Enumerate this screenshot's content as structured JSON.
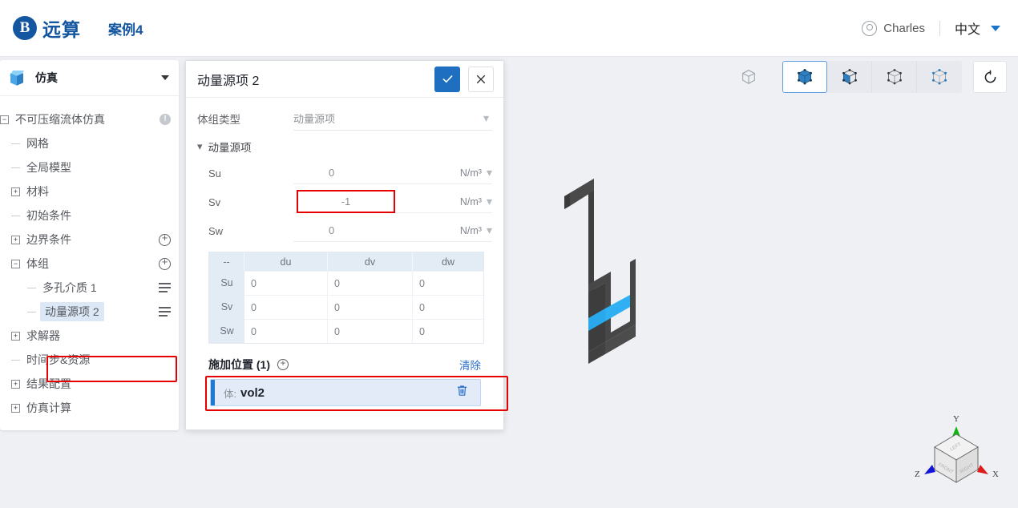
{
  "header": {
    "logo_letter": "B",
    "logo_text": "远算",
    "case_name": "案例4",
    "user_name": "Charles",
    "user_icon": "user-circle-icon",
    "language": "中文",
    "language_caret": "caret-down-icon"
  },
  "sidebar": {
    "title": "仿真",
    "title_icon": "cube-icon",
    "collapse_icon": "caret-down-icon",
    "tree": [
      {
        "label": "不可压缩流体仿真",
        "level": 0,
        "toggle": "minus",
        "badge": "warning-icon",
        "selected": false
      },
      {
        "label": "网格",
        "level": 1,
        "toggle": "dash",
        "badge": "",
        "selected": false
      },
      {
        "label": "全局模型",
        "level": 1,
        "toggle": "dash",
        "badge": "",
        "selected": false
      },
      {
        "label": "材料",
        "level": 1,
        "toggle": "plus",
        "badge": "",
        "selected": false
      },
      {
        "label": "初始条件",
        "level": 1,
        "toggle": "dash",
        "badge": "",
        "selected": false
      },
      {
        "label": "边界条件",
        "level": 1,
        "toggle": "plus",
        "badge": "add-icon",
        "selected": false
      },
      {
        "label": "体组",
        "level": 1,
        "toggle": "minus",
        "badge": "add-icon",
        "selected": false
      },
      {
        "label": "多孔介质 1",
        "level": 2,
        "toggle": "dash",
        "badge": "list-icon",
        "selected": false
      },
      {
        "label": "动量源项 2",
        "level": 2,
        "toggle": "dash",
        "badge": "list-icon",
        "selected": true
      },
      {
        "label": "求解器",
        "level": 1,
        "toggle": "plus",
        "badge": "",
        "selected": false
      },
      {
        "label": "时间步&资源",
        "level": 1,
        "toggle": "dash",
        "badge": "",
        "selected": false
      },
      {
        "label": "结果配置",
        "level": 1,
        "toggle": "plus",
        "badge": "",
        "selected": false
      },
      {
        "label": "仿真计算",
        "level": 1,
        "toggle": "plus",
        "badge": "",
        "selected": false
      }
    ]
  },
  "panel": {
    "title": "动量源项 2",
    "confirm_icon": "check-icon",
    "cancel_icon": "close-icon",
    "type_label": "体组类型",
    "type_value": "动量源项",
    "type_chevron": "chevron-down-icon",
    "section_title": "动量源项",
    "section_chevron": "chevron-down-icon",
    "source_rows": [
      {
        "name": "Su",
        "value": "0",
        "unit": "N/m³",
        "highlighted": false
      },
      {
        "name": "Sv",
        "value": "-1",
        "unit": "N/m³",
        "highlighted": true
      },
      {
        "name": "Sw",
        "value": "0",
        "unit": "N/m³",
        "highlighted": false
      }
    ],
    "matrix": {
      "headers": [
        "--",
        "du",
        "dv",
        "dw"
      ],
      "rows": [
        {
          "label": "Su",
          "values": [
            "0",
            "0",
            "0"
          ]
        },
        {
          "label": "Sv",
          "values": [
            "0",
            "0",
            "0"
          ]
        },
        {
          "label": "Sw",
          "values": [
            "0",
            "0",
            "0"
          ]
        }
      ]
    },
    "apply": {
      "title": "施加位置 (1)",
      "add_icon": "add-circle-icon",
      "clear_label": "清除",
      "items": [
        {
          "prefix": "体:",
          "name": "vol2",
          "delete_icon": "trash-icon"
        }
      ]
    }
  },
  "viewport": {
    "toolbar": [
      {
        "name": "body-select-ghost",
        "icon": "cube-outline-icon",
        "active": false,
        "grouped": false
      },
      {
        "name": "solid-select",
        "icon": "cube-solid-icon",
        "active": true,
        "grouped": true
      },
      {
        "name": "face-select",
        "icon": "cube-face-icon",
        "active": false,
        "grouped": true
      },
      {
        "name": "edge-select",
        "icon": "cube-edge-icon",
        "active": false,
        "grouped": true
      },
      {
        "name": "vertex-select",
        "icon": "cube-vertex-icon",
        "active": false,
        "grouped": true
      }
    ],
    "reset_icon": "reset-view-icon",
    "axis_labels": {
      "x": "X",
      "y": "Y",
      "z": "Z"
    },
    "cube_faces": {
      "top": "LEFT",
      "front": "FRONT",
      "right": "RIGHT"
    },
    "colors": {
      "x_axis": "#e01b1b",
      "y_axis": "#12b312",
      "z_axis": "#1414d8",
      "geometry": "#464646",
      "selection": "#29a8ec"
    }
  },
  "colors": {
    "brand": "#1457a0",
    "accent": "#1f6fc0",
    "highlight_red": "#e60000",
    "selected_row": "#dce8f6"
  }
}
